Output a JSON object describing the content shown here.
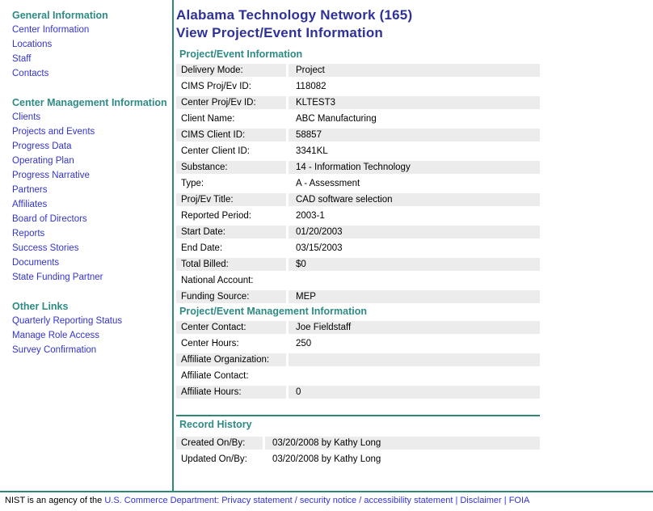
{
  "colors": {
    "title_navy": "#2e3199",
    "header_teal": "#2e8b84",
    "line_teal": "#2f8874",
    "link_blue": "#3333cc",
    "row_gray": "#ececec"
  },
  "sidebar": {
    "sections": [
      {
        "header": "General Information",
        "items": [
          "Center Information",
          "Locations",
          "Staff",
          "Contacts"
        ]
      },
      {
        "header": "Center Management Information",
        "items": [
          "Clients",
          "Projects and Events",
          "Progress Data",
          "Operating Plan",
          "Progress Narrative",
          "Partners",
          "Affiliates",
          "Board of Directors",
          "Reports",
          "Success Stories",
          "Documents",
          "State Funding Partner"
        ]
      },
      {
        "header": "Other Links",
        "items": [
          "Quarterly Reporting Status",
          "Manage Role Access",
          "Survey Confirmation"
        ]
      }
    ]
  },
  "header": {
    "title_line1": "Alabama Technology Network (165)",
    "title_line2": "View Project/Event Information"
  },
  "main": {
    "sections": [
      {
        "header": "Project/Event Information",
        "rows": [
          {
            "label": "Delivery Mode:",
            "value": "Project"
          },
          {
            "label": "CIMS Proj/Ev ID:",
            "value": "118082"
          },
          {
            "label": "Center Proj/Ev ID:",
            "value": "KLTEST3"
          },
          {
            "label": "Client Name:",
            "value": "ABC Manufacturing"
          },
          {
            "label": "CIMS Client ID:",
            "value": "58857"
          },
          {
            "label": "Center Client ID:",
            "value": "3341KL"
          },
          {
            "label": "Substance:",
            "value": "14 - Information Technology"
          },
          {
            "label": "Type:",
            "value": "A - Assessment"
          },
          {
            "label": "Proj/Ev Title:",
            "value": "CAD software selection"
          },
          {
            "label": "Reported Period:",
            "value": "2003-1"
          },
          {
            "label": "Start Date:",
            "value": "01/20/2003"
          },
          {
            "label": "End Date:",
            "value": "03/15/2003"
          },
          {
            "label": "Total Billed:",
            "value": "$0"
          },
          {
            "label": "National Account:",
            "value": ""
          },
          {
            "label": "Funding Source:",
            "value": "MEP"
          }
        ]
      },
      {
        "header": "Project/Event Management Information",
        "rows": [
          {
            "label": "Center Contact:",
            "value": "Joe Fieldstaff"
          },
          {
            "label": "Center Hours:",
            "value": "250"
          },
          {
            "label": "Affiliate Organization:",
            "value": ""
          },
          {
            "label": "Affiliate Contact:",
            "value": ""
          },
          {
            "label": "Affiliate Hours:",
            "value": "0"
          }
        ]
      },
      {
        "header": "Record History",
        "rows": [
          {
            "label": "Created On/By:",
            "value": "03/20/2008 by Kathy Long"
          },
          {
            "label": "Updated On/By:",
            "value": "03/20/2008 by Kathy Long"
          }
        ]
      }
    ]
  },
  "footer": {
    "prefix": "NIST is an agency of the",
    "commerce_link": "U.S. Commerce Department:",
    "privacy_link": "Privacy statement",
    "security_link": "security notice",
    "accessibility_link": "accessibility statement",
    "disclaimer_link": "Disclaimer",
    "foia_link": "FOIA",
    "sep_slash": "/",
    "sep_pipe": "|"
  }
}
